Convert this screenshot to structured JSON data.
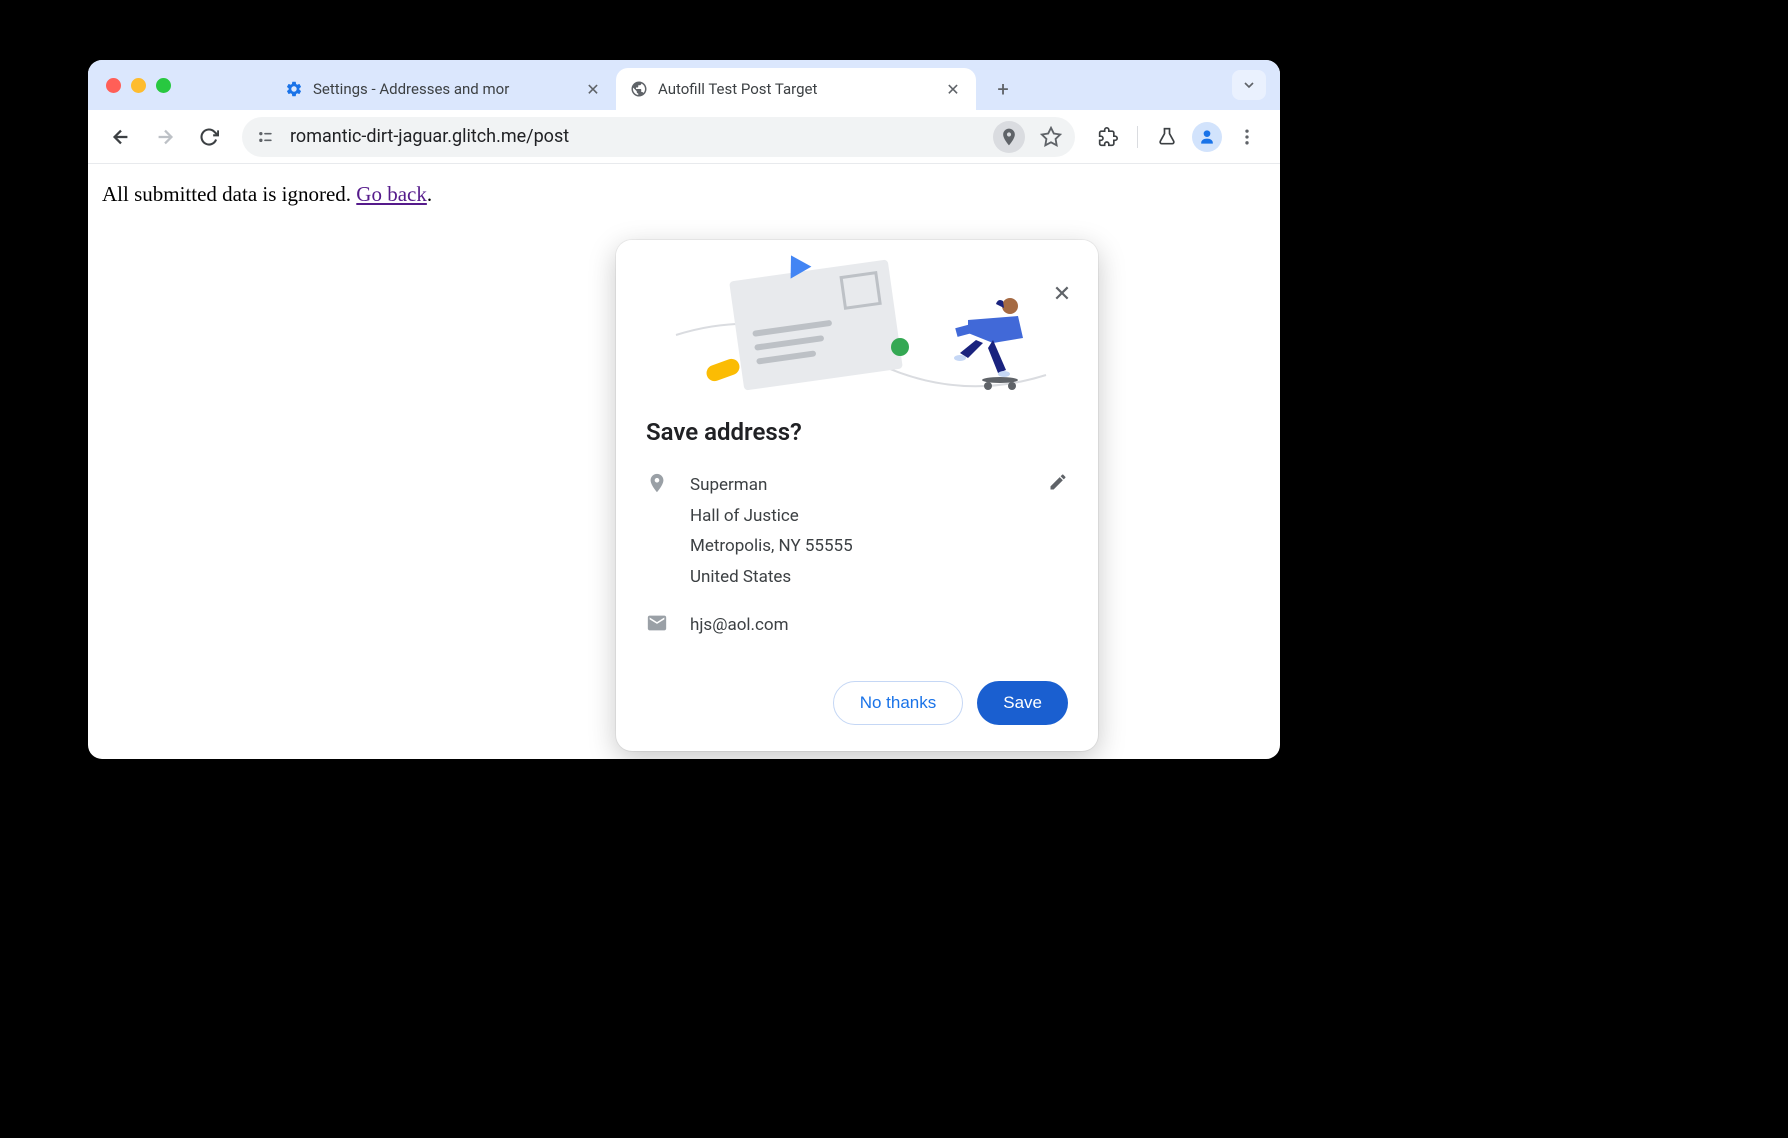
{
  "tabs": [
    {
      "title": "Settings - Addresses and mor",
      "favicon": "gear"
    },
    {
      "title": "Autofill Test Post Target",
      "favicon": "globe"
    }
  ],
  "url": "romantic-dirt-jaguar.glitch.me/post",
  "page": {
    "text_before_link": "All submitted data is ignored. ",
    "link_text": "Go back",
    "text_after_link": "."
  },
  "dialog": {
    "title": "Save address?",
    "address": {
      "name": "Superman",
      "line1": "Hall of Justice",
      "line2": "Metropolis, NY 55555",
      "country": "United States"
    },
    "email": "hjs@aol.com",
    "actions": {
      "secondary": "No thanks",
      "primary": "Save"
    }
  }
}
